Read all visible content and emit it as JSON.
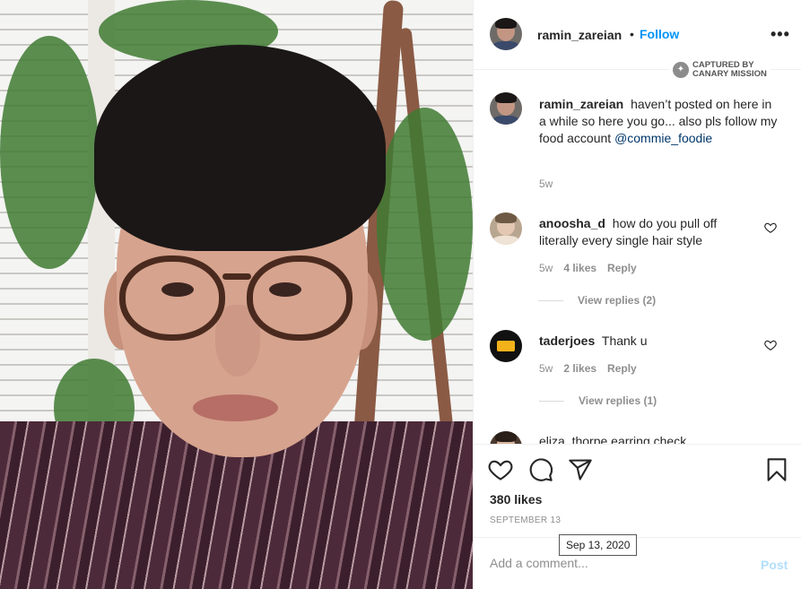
{
  "post": {
    "photo_alt": "selfie"
  },
  "header": {
    "username": "ramin_zareian",
    "separator": "•",
    "follow_label": "Follow",
    "more_label": "•••"
  },
  "watermark": {
    "icon": "canary-icon",
    "line1": "CAPTURED BY",
    "line2": "CANARY MISSION"
  },
  "caption": {
    "username": "ramin_zareian",
    "text": "haven’t posted on here in a while so here you go... also pls follow my food account",
    "mention": "@commie_foodie",
    "time": "5w"
  },
  "comments": [
    {
      "username": "anoosha_d",
      "text": "how do you pull off literally every single hair style",
      "time": "5w",
      "likes": "4 likes",
      "reply": "Reply",
      "view_replies": "View replies (2)"
    },
    {
      "username": "taderjoes",
      "text": "Thank u",
      "time": "5w",
      "likes": "2 likes",
      "reply": "Reply",
      "view_replies": "View replies (1)"
    }
  ],
  "partial_comment": {
    "text": "eliza_thorpe earring check"
  },
  "actions": {
    "likes": "380 likes",
    "date": "SEPTEMBER 13",
    "tooltip": "Sep 13, 2020"
  },
  "add_comment": {
    "placeholder": "Add a comment...",
    "post_label": "Post"
  }
}
